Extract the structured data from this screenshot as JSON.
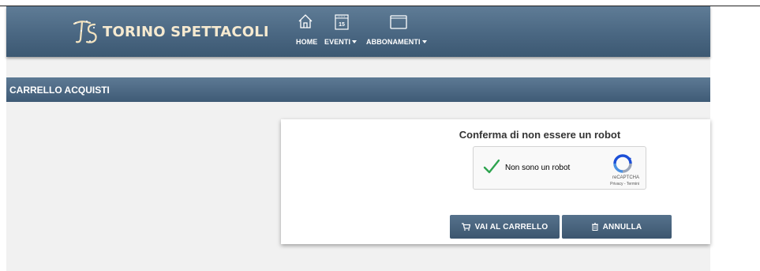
{
  "brand": {
    "name": "TORINO SPETTACOLI",
    "logo_icon": "ts-monogram-icon"
  },
  "nav": {
    "items": [
      {
        "label": "HOME",
        "icon": "home-icon",
        "has_dropdown": false
      },
      {
        "label": "EVENTI",
        "icon": "calendar-icon",
        "icon_text": "15",
        "has_dropdown": true
      },
      {
        "label": "ABBONAMENTI",
        "icon": "card-icon",
        "has_dropdown": true
      }
    ]
  },
  "page": {
    "title": "CARRELLO ACQUISTI"
  },
  "captcha_panel": {
    "heading": "Conferma di non essere un robot",
    "checkbox_label": "Non sono un robot",
    "checked": true,
    "brand": "reCAPTCHA",
    "links": "Privacy - Termini"
  },
  "buttons": {
    "cart": {
      "label": "VAI AL CARRELLO",
      "icon": "cart-icon"
    },
    "cancel": {
      "label": "ANNULLA",
      "icon": "trash-icon"
    }
  },
  "colors": {
    "header": "#4a6782",
    "button": "#4a6580",
    "check": "#2ea44f",
    "logo_text": "#f6ead0"
  }
}
